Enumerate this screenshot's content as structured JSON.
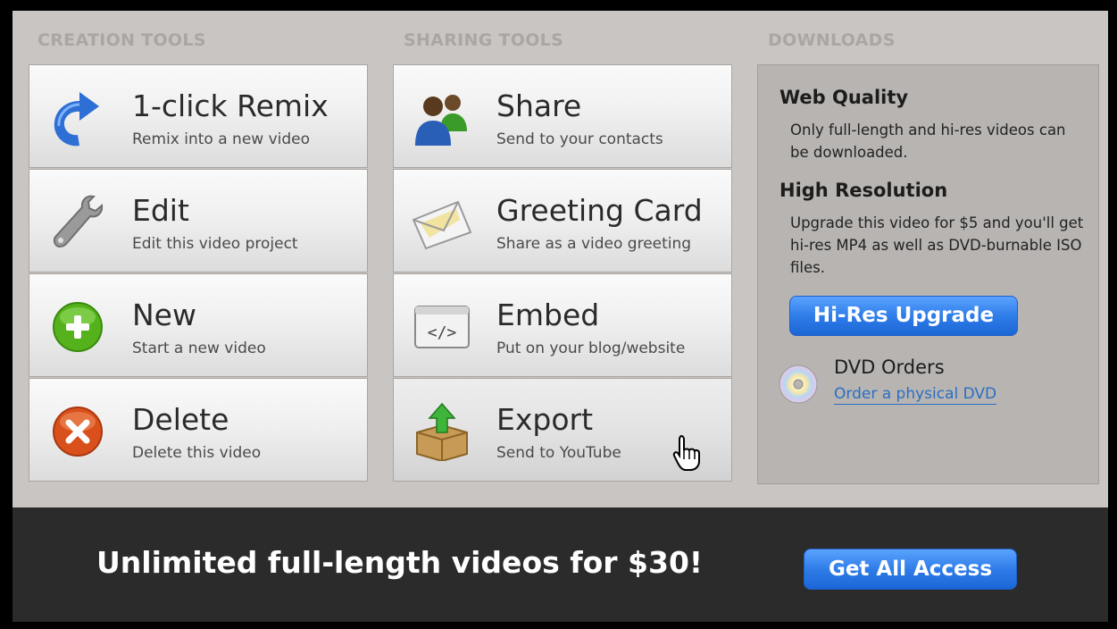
{
  "columns": {
    "creation": "Creation Tools",
    "sharing": "Sharing Tools",
    "downloads": "Downloads"
  },
  "creation_tools": [
    {
      "title": "1-click Remix",
      "subtitle": "Remix into a new video",
      "icon": "remix-arrow-icon"
    },
    {
      "title": "Edit",
      "subtitle": "Edit this video project",
      "icon": "wrench-icon"
    },
    {
      "title": "New",
      "subtitle": "Start a new video",
      "icon": "plus-circle-icon"
    },
    {
      "title": "Delete",
      "subtitle": "Delete this video",
      "icon": "x-circle-icon"
    }
  ],
  "sharing_tools": [
    {
      "title": "Share",
      "subtitle": "Send to your contacts",
      "icon": "people-icon"
    },
    {
      "title": "Greeting Card",
      "subtitle": "Share as a video greeting",
      "icon": "envelope-icon"
    },
    {
      "title": "Embed",
      "subtitle": "Put on your blog/website",
      "icon": "code-window-icon"
    },
    {
      "title": "Export",
      "subtitle": "Send to YouTube",
      "icon": "box-upload-icon"
    }
  ],
  "downloads": {
    "web_quality_heading": "Web Quality",
    "web_quality_text": "Only full-length and hi-res videos can be downloaded.",
    "high_res_heading": "High Resolution",
    "high_res_text": "Upgrade this video for $5 and you'll get hi-res MP4 as well as DVD-burnable ISO files.",
    "upgrade_button": "Hi-Res Upgrade",
    "dvd_title": "DVD Orders",
    "dvd_link": "Order a physical DVD"
  },
  "promo": {
    "text": "Unlimited full-length videos for $30!",
    "button": "Get All Access"
  },
  "colors": {
    "accent": "#2f7de9",
    "bar": "#2b2b2b",
    "panel": "#c9c5c3"
  }
}
